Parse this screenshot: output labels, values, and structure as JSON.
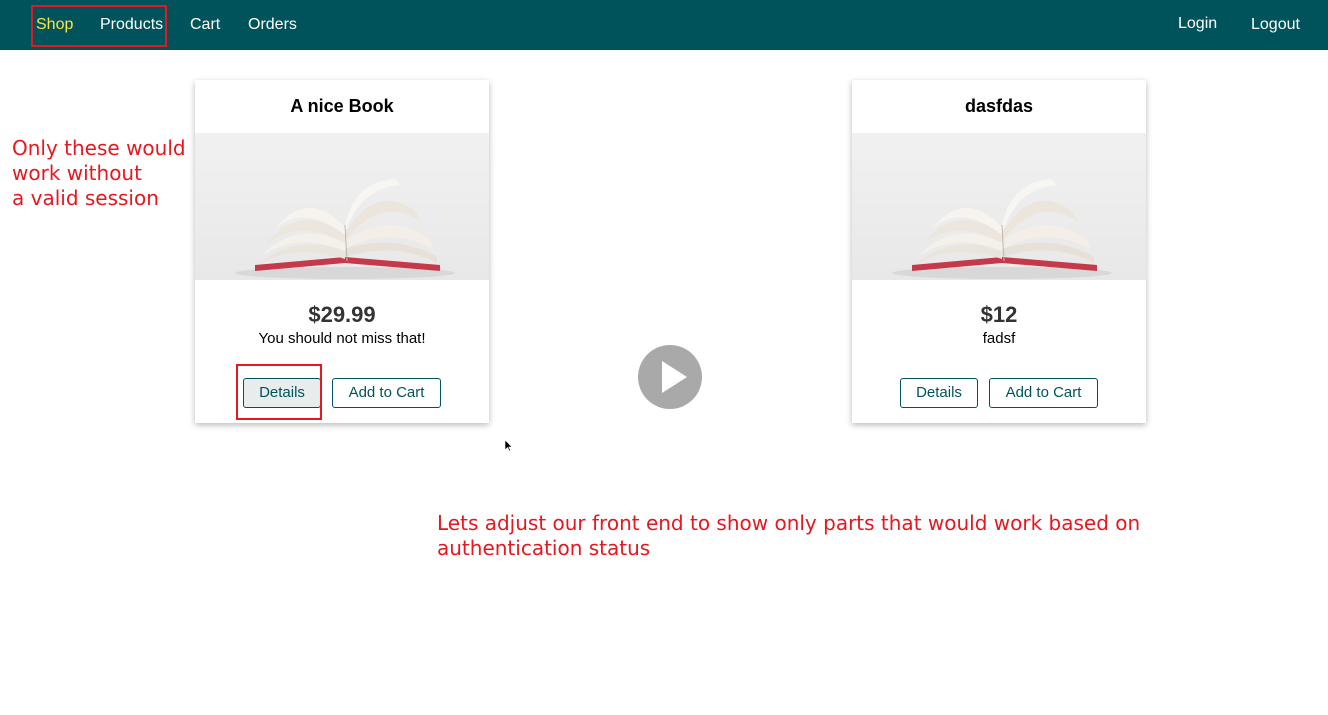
{
  "nav": {
    "left": [
      {
        "label": "Shop",
        "active": true
      },
      {
        "label": "Products",
        "active": false
      },
      {
        "label": "Cart",
        "active": false
      },
      {
        "label": "Orders",
        "active": false
      }
    ],
    "right": [
      {
        "label": "Login"
      },
      {
        "label": "Logout"
      }
    ]
  },
  "products": [
    {
      "title": "A nice Book",
      "price": "$29.99",
      "description": "You should not miss that!",
      "details_label": "Details",
      "cart_label": "Add to Cart"
    },
    {
      "title": "dasfdas",
      "price": "$12",
      "description": "fadsf",
      "details_label": "Details",
      "cart_label": "Add to Cart"
    }
  ],
  "annotations": {
    "left_note": [
      "Only these would",
      "work without",
      "a valid session"
    ],
    "bottom_note": [
      "Lets adjust our front end to show only parts that would work based on",
      "authentication status"
    ]
  },
  "colors": {
    "navbar": "#00535a",
    "active_link": "#ffe343",
    "annotation": "#e6171f"
  }
}
